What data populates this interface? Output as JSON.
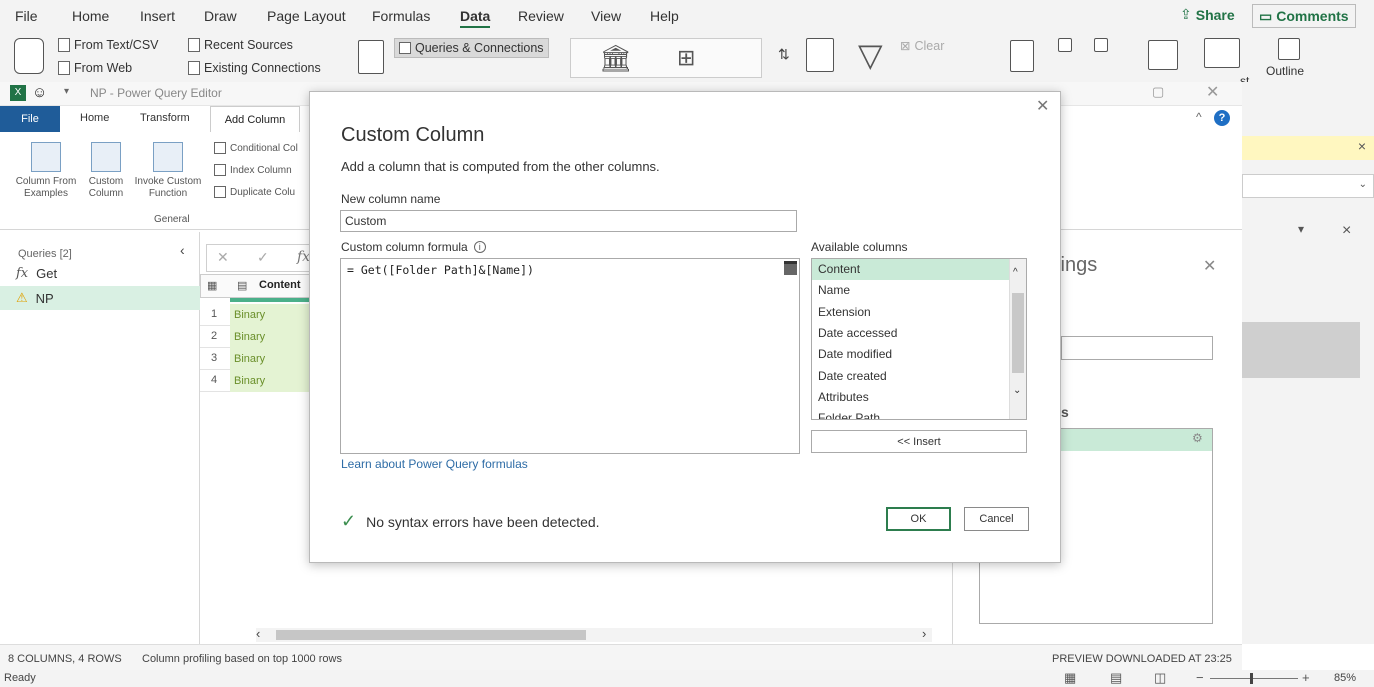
{
  "excel": {
    "menu": [
      "File",
      "Home",
      "Insert",
      "Draw",
      "Page Layout",
      "Formulas",
      "Data",
      "Review",
      "View",
      "Help"
    ],
    "active_menu": "Data",
    "share_label": "Share",
    "comments_label": "Comments",
    "ribbon": {
      "from_text_csv": "From Text/CSV",
      "from_web": "From Web",
      "recent_sources": "Recent Sources",
      "existing_connections": "Existing Connections",
      "queries_connections": "Queries & Connections",
      "clear": "Clear",
      "outline": "Outline",
      "st_fragment": "st"
    },
    "status_ready": "Ready",
    "zoom": "85%"
  },
  "power_query": {
    "window_title": "NP - Power Query Editor",
    "tabs": [
      "File",
      "Home",
      "Transform",
      "Add Column"
    ],
    "ribbon": {
      "column_from_examples_1": "Column From",
      "column_from_examples_2": "Examples",
      "custom_column_1": "Custom",
      "custom_column_2": "Column",
      "invoke_function_1": "Invoke Custom",
      "invoke_function_2": "Function",
      "conditional_column": "Conditional Col",
      "index_column": "Index Column",
      "duplicate_column": "Duplicate Colu",
      "group_general": "General"
    },
    "queries_header": "Queries [2]",
    "queries": [
      "Get",
      "NP"
    ],
    "grid": {
      "column_header": "Content",
      "rows": [
        {
          "num": "1",
          "value": "Binary"
        },
        {
          "num": "2",
          "value": "Binary"
        },
        {
          "num": "3",
          "value": "Binary"
        },
        {
          "num": "4",
          "value": "Binary"
        }
      ]
    },
    "settings_fragment": "tings",
    "settings_fragment_2": "s",
    "status_left": "8 COLUMNS, 4 ROWS",
    "status_profiling": "Column profiling based on top 1000 rows",
    "status_right": "PREVIEW DOWNLOADED AT 23:25"
  },
  "dialog": {
    "title": "Custom Column",
    "description": "Add a column that is computed from the other columns.",
    "new_column_label": "New column name",
    "new_column_value": "Custom",
    "formula_label": "Custom column formula",
    "formula_value": "= Get([Folder Path]&[Name])",
    "available_columns_label": "Available columns",
    "available_columns": [
      "Content",
      "Name",
      "Extension",
      "Date accessed",
      "Date modified",
      "Date created",
      "Attributes",
      "Folder Path"
    ],
    "insert_button": "<< Insert",
    "learn_link": "Learn about Power Query formulas",
    "syntax_message": "No syntax errors have been detected.",
    "ok_button": "OK",
    "cancel_button": "Cancel"
  }
}
